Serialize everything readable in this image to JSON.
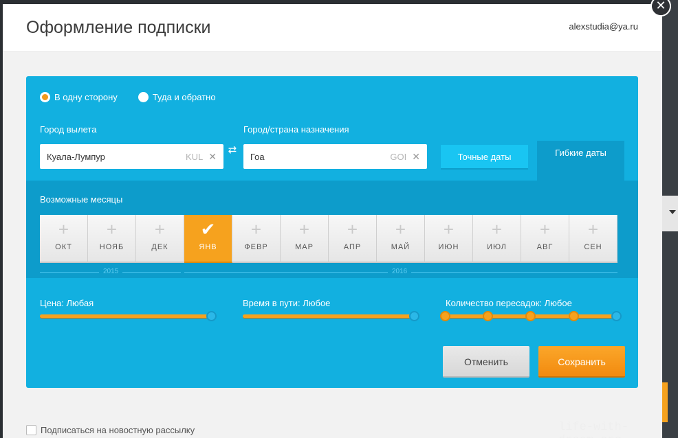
{
  "header": {
    "title": "Оформление подписки",
    "user_email": "alexstudia@ya.ru",
    "close_label": "✕"
  },
  "trip_type": {
    "options": [
      {
        "label": "В одну сторону",
        "checked": true
      },
      {
        "label": "Туда и обратно",
        "checked": false
      }
    ]
  },
  "origin": {
    "label": "Город вылета",
    "value": "Куала-Лумпур",
    "code": "KUL"
  },
  "destination": {
    "label": "Город/страна назначения",
    "value": "Гоа",
    "code": "GOI"
  },
  "date_mode": {
    "exact_label": "Точные даты",
    "flexible_label": "Гибкие даты",
    "active": "flexible"
  },
  "months": {
    "label": "Возможные месяцы",
    "items": [
      {
        "name": "ОКТ",
        "selected": false
      },
      {
        "name": "НОЯБ",
        "selected": false
      },
      {
        "name": "ДЕК",
        "selected": false
      },
      {
        "name": "ЯНВ",
        "selected": true
      },
      {
        "name": "ФЕВР",
        "selected": false
      },
      {
        "name": "МАР",
        "selected": false
      },
      {
        "name": "АПР",
        "selected": false
      },
      {
        "name": "МАЙ",
        "selected": false
      },
      {
        "name": "ИЮН",
        "selected": false
      },
      {
        "name": "ИЮЛ",
        "selected": false
      },
      {
        "name": "АВГ",
        "selected": false
      },
      {
        "name": "СЕН",
        "selected": false
      }
    ],
    "years": [
      "2015",
      "2016"
    ]
  },
  "filters": {
    "price_label": "Цена: Любая",
    "duration_label": "Время в пути: Любое",
    "stops_label": "Количество пересадок: Любое"
  },
  "actions": {
    "cancel_label": "Отменить",
    "save_label": "Сохранить"
  },
  "newsletter": {
    "label": "Подписаться на новостную рассылку",
    "checked": false
  },
  "watermark": "life-with-dream.org",
  "colors": {
    "panel": "#12b0e0",
    "panel_dark": "#0d9ccb",
    "accent": "#f6a21e"
  }
}
